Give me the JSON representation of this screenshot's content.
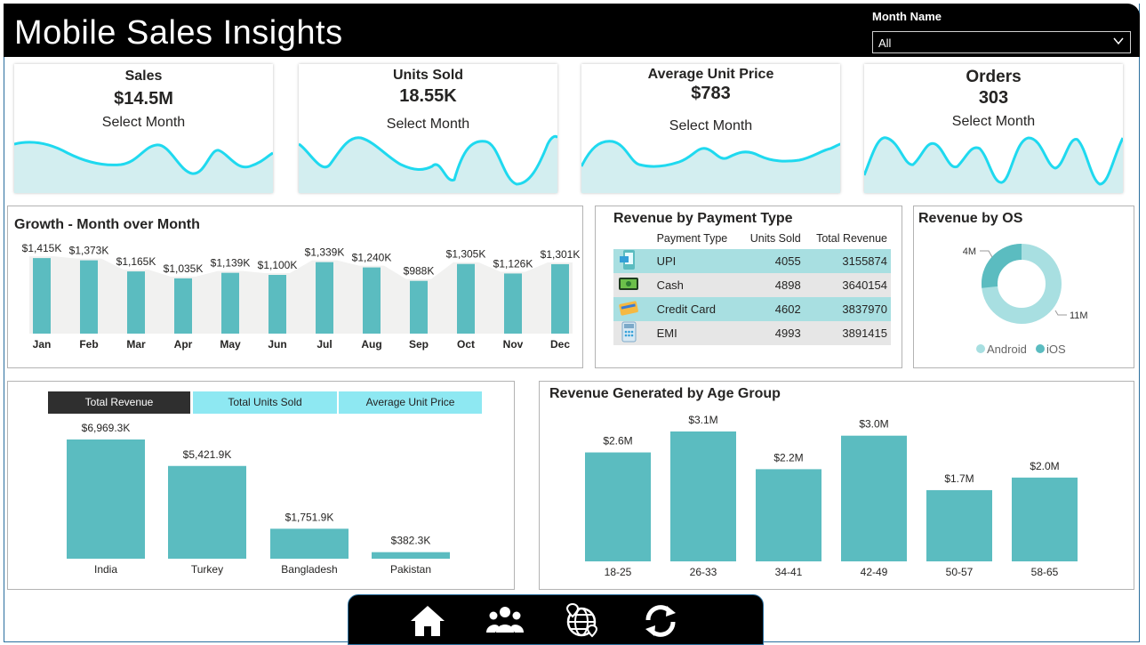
{
  "header": {
    "title": "Mobile Sales Insights",
    "slicer_label": "Month Name",
    "slicer_value": "All"
  },
  "kpis": [
    {
      "title": "Sales",
      "value": "$14.5M",
      "sub": "Select Month"
    },
    {
      "title": "Units Sold",
      "value": "18.55K",
      "sub": "Select Month"
    },
    {
      "title": "Average Unit Price",
      "value": "$783",
      "sub": "Select Month"
    },
    {
      "title": "Orders",
      "value": "303",
      "sub": "Select Month"
    }
  ],
  "growth": {
    "title": "Growth - Month over Month",
    "months": [
      "Jan",
      "Feb",
      "Mar",
      "Apr",
      "May",
      "Jun",
      "Jul",
      "Aug",
      "Sep",
      "Oct",
      "Nov",
      "Dec"
    ],
    "labels": [
      "$1,415K",
      "$1,373K",
      "$1,165K",
      "$1,035K",
      "$1,139K",
      "$1,100K",
      "$1,339K",
      "$1,240K",
      "$988K",
      "$1,305K",
      "$1,126K",
      "$1,301K"
    ],
    "values": [
      1415,
      1373,
      1165,
      1035,
      1139,
      1100,
      1339,
      1240,
      988,
      1305,
      1126,
      1301
    ]
  },
  "payment": {
    "title": "Revenue by Payment Type",
    "headers": [
      "Payment Type",
      "Units Sold",
      "Total Revenue"
    ],
    "rows": [
      {
        "icon": "mobile-pay-icon",
        "type": "UPI",
        "units": "4055",
        "revenue": "3155874"
      },
      {
        "icon": "cash-icon",
        "type": "Cash",
        "units": "4898",
        "revenue": "3640154"
      },
      {
        "icon": "credit-card-icon",
        "type": "Credit Card",
        "units": "4602",
        "revenue": "3837970"
      },
      {
        "icon": "calculator-icon",
        "type": "EMI",
        "units": "4993",
        "revenue": "3891415"
      }
    ]
  },
  "os": {
    "title": "Revenue by OS",
    "label_ios": "4M",
    "label_android": "11M",
    "legend": [
      "Android",
      "iOS"
    ],
    "values": {
      "Android": 11,
      "iOS": 4
    },
    "colors": {
      "Android": "#a8dfe1",
      "iOS": "#5bbcc0"
    }
  },
  "country": {
    "tabs": [
      "Total Revenue",
      "Total Units Sold",
      "Average Unit Price"
    ],
    "categories": [
      "India",
      "Turkey",
      "Bangladesh",
      "Pakistan"
    ],
    "labels": [
      "$6,969.3K",
      "$5,421.9K",
      "$1,751.9K",
      "$382.3K"
    ],
    "values": [
      6969.3,
      5421.9,
      1751.9,
      382.3
    ]
  },
  "age": {
    "title": "Revenue Generated by Age Group",
    "categories": [
      "18-25",
      "26-33",
      "34-41",
      "42-49",
      "50-57",
      "58-65"
    ],
    "labels": [
      "$2.6M",
      "$3.1M",
      "$2.2M",
      "$3.0M",
      "$1.7M",
      "$2.0M"
    ],
    "values": [
      2.6,
      3.1,
      2.2,
      3.0,
      1.7,
      2.0
    ]
  },
  "nav": [
    "home-icon",
    "users-icon",
    "globe-location-icon",
    "refresh-icon"
  ],
  "colors": {
    "bar": "#5bbcc0",
    "spark": "#1fd9ef",
    "spark_fill": "#d3eef0",
    "header": "#000000",
    "tab_active": "#2f2f2f",
    "tab_inactive": "#8ee8f2"
  }
}
